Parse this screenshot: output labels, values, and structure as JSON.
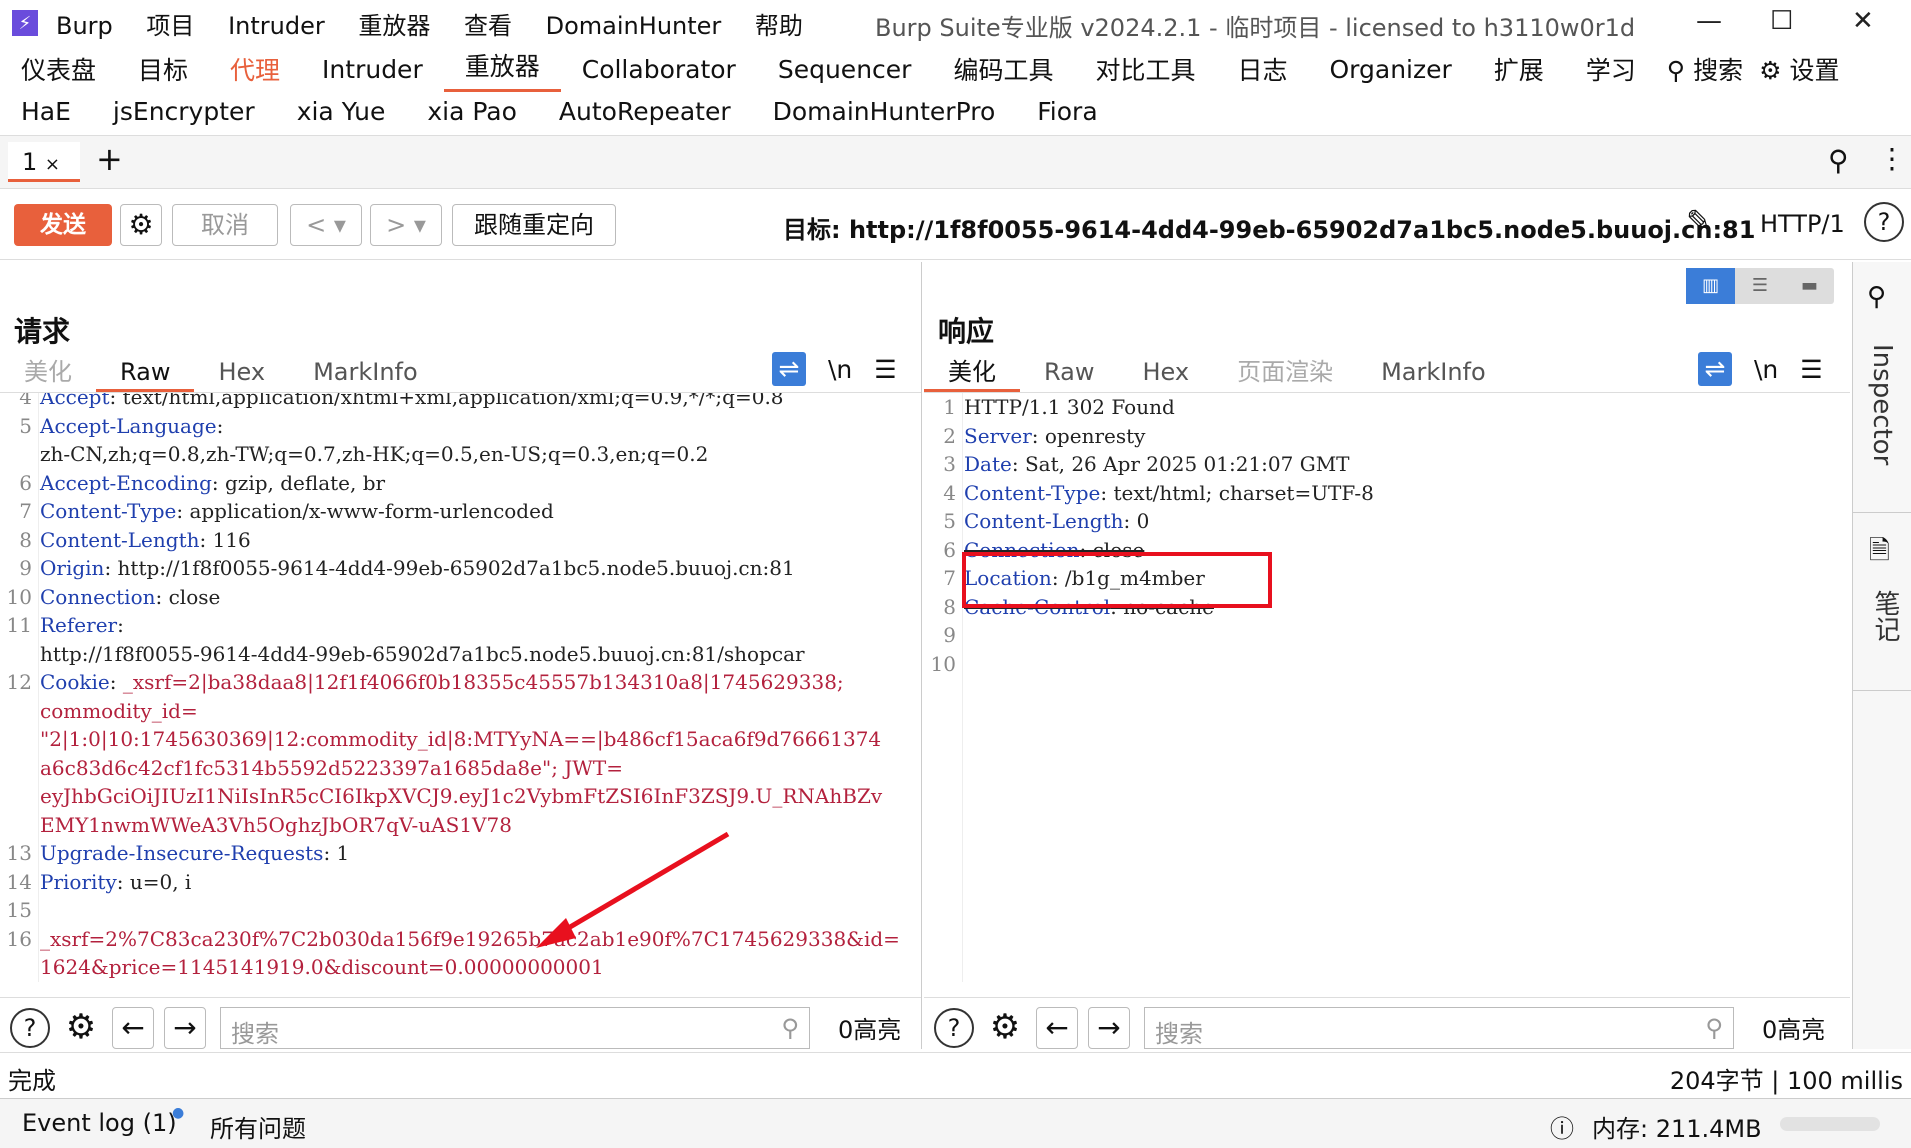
{
  "titlebar": {
    "app": "Burp",
    "menus": [
      "项目",
      "Intruder",
      "重放器",
      "查看",
      "DomainHunter",
      "帮助"
    ],
    "title": "Burp Suite专业版  v2024.2.1 - 临时项目 - licensed to h3110w0r1d",
    "controls": [
      "—",
      "☐",
      "✕"
    ]
  },
  "nav1": [
    "仪表盘",
    "目标",
    "代理",
    "Intruder",
    "重放器",
    "Collaborator",
    "Sequencer",
    "编码工具",
    "对比工具",
    "日志",
    "Organizer",
    "扩展",
    "学习",
    "搜索",
    "设置"
  ],
  "nav2": [
    "HaE",
    "jsEncrypter",
    "xia Yue",
    "xia Pao",
    "AutoRepeater",
    "DomainHunterPro",
    "Fiora"
  ],
  "tab": {
    "label": "1",
    "close": "×",
    "add": "+"
  },
  "toolbar": {
    "send": "发送",
    "cancel": "取消",
    "follow": "跟随重定向",
    "target": "目标: http://1f8f0055-9614-4dd4-99eb-65902d7a1bc5.node5.buuoj.cn:81",
    "protocol": "HTTP/1"
  },
  "request": {
    "title": "请求",
    "tabs": [
      "美化",
      "Raw",
      "Hex",
      "MarkInfo"
    ],
    "wrap": "\\n",
    "lines": [
      {
        "n": "4",
        "k": "Accept",
        "v": ": text/html,application/xhtml+xml,application/xml;q=0.9,*/*;q=0.8"
      },
      {
        "n": "5",
        "k": "Accept-Language",
        "v": ":"
      },
      {
        "n": "",
        "k": "",
        "v": "zh-CN,zh;q=0.8,zh-TW;q=0.7,zh-HK;q=0.5,en-US;q=0.3,en;q=0.2"
      },
      {
        "n": "6",
        "k": "Accept-Encoding",
        "v": ": gzip, deflate, br"
      },
      {
        "n": "7",
        "k": "Content-Type",
        "v": ": application/x-www-form-urlencoded"
      },
      {
        "n": "8",
        "k": "Content-Length",
        "v": ": 116"
      },
      {
        "n": "9",
        "k": "Origin",
        "v": ": http://1f8f0055-9614-4dd4-99eb-65902d7a1bc5.node5.buuoj.cn:81"
      },
      {
        "n": "10",
        "k": "Connection",
        "v": ": close"
      },
      {
        "n": "11",
        "k": "Referer",
        "v": ":"
      },
      {
        "n": "",
        "k": "",
        "v": "http://1f8f0055-9614-4dd4-99eb-65902d7a1bc5.node5.buuoj.cn:81/shopcar"
      },
      {
        "n": "12",
        "k": "Cookie",
        "v": ": ",
        "r": "_xsrf=2|ba38daa8|12f1f4066f0b18355c45557b134310a8|1745629338;"
      },
      {
        "n": "",
        "k": "",
        "v": "",
        "r": "commodity_id="
      },
      {
        "n": "",
        "k": "",
        "v": "",
        "r": "\"2|1:0|10:1745630369|12:commodity_id|8:MTYyNA==|b486cf15aca6f9d76661374"
      },
      {
        "n": "",
        "k": "",
        "v": "",
        "r": "a6c83d6c42cf1fc5314b5592d5223397a1685da8e\"; JWT="
      },
      {
        "n": "",
        "k": "",
        "v": "",
        "r": "eyJhbGciOiJIUzI1NiIsInR5cCI6IkpXVCJ9.eyJ1c2VybmFtZSI6InF3ZSJ9.U_RNAhBZv"
      },
      {
        "n": "",
        "k": "",
        "v": "",
        "r": "EMY1nwmWWeA3Vh5OghzJbOR7qV-uAS1V78"
      },
      {
        "n": "13",
        "k": "Upgrade-Insecure-Requests",
        "v": ": 1"
      },
      {
        "n": "14",
        "k": "Priority",
        "v": ": u=0, i"
      },
      {
        "n": "15",
        "k": "",
        "v": ""
      },
      {
        "n": "16",
        "k": "",
        "v": "",
        "r": "_xsrf=2%7C83ca230f%7C2b030da156f9e19265b7ac2ab1e90f%7C1745629338&id="
      },
      {
        "n": "",
        "k": "",
        "v": "",
        "r": "1624&price=1145141919.0&discount=0.00000000001"
      }
    ],
    "search": "搜索",
    "highlights": "0高亮"
  },
  "response": {
    "title": "响应",
    "tabs": [
      "美化",
      "Raw",
      "Hex",
      "页面渲染",
      "MarkInfo"
    ],
    "wrap": "\\n",
    "lines": [
      {
        "n": "1",
        "k": "",
        "v": "HTTP/1.1 302 Found"
      },
      {
        "n": "2",
        "k": "Server",
        "v": ": openresty"
      },
      {
        "n": "3",
        "k": "Date",
        "v": ": Sat, 26 Apr 2025 01:21:07 GMT"
      },
      {
        "n": "4",
        "k": "Content-Type",
        "v": ": text/html; charset=UTF-8"
      },
      {
        "n": "5",
        "k": "Content-Length",
        "v": ": 0"
      },
      {
        "n": "6",
        "k": "Connection",
        "v": ": close"
      },
      {
        "n": "7",
        "k": "Location",
        "v": ": /b1g_m4mber"
      },
      {
        "n": "8",
        "k": "Cache-Control",
        "v": ": no-cache"
      },
      {
        "n": "9",
        "k": "",
        "v": ""
      },
      {
        "n": "10",
        "k": "",
        "v": ""
      }
    ],
    "search": "搜索",
    "highlights": "0高亮"
  },
  "inspector": {
    "label": "Inspector",
    "notes": "笔记"
  },
  "status": {
    "left": "完成",
    "right": "204字节 | 100 millis"
  },
  "footer": {
    "eventlog": "Event log (1)",
    "issues": "所有问题",
    "memory": "内存: 211.4MB"
  }
}
